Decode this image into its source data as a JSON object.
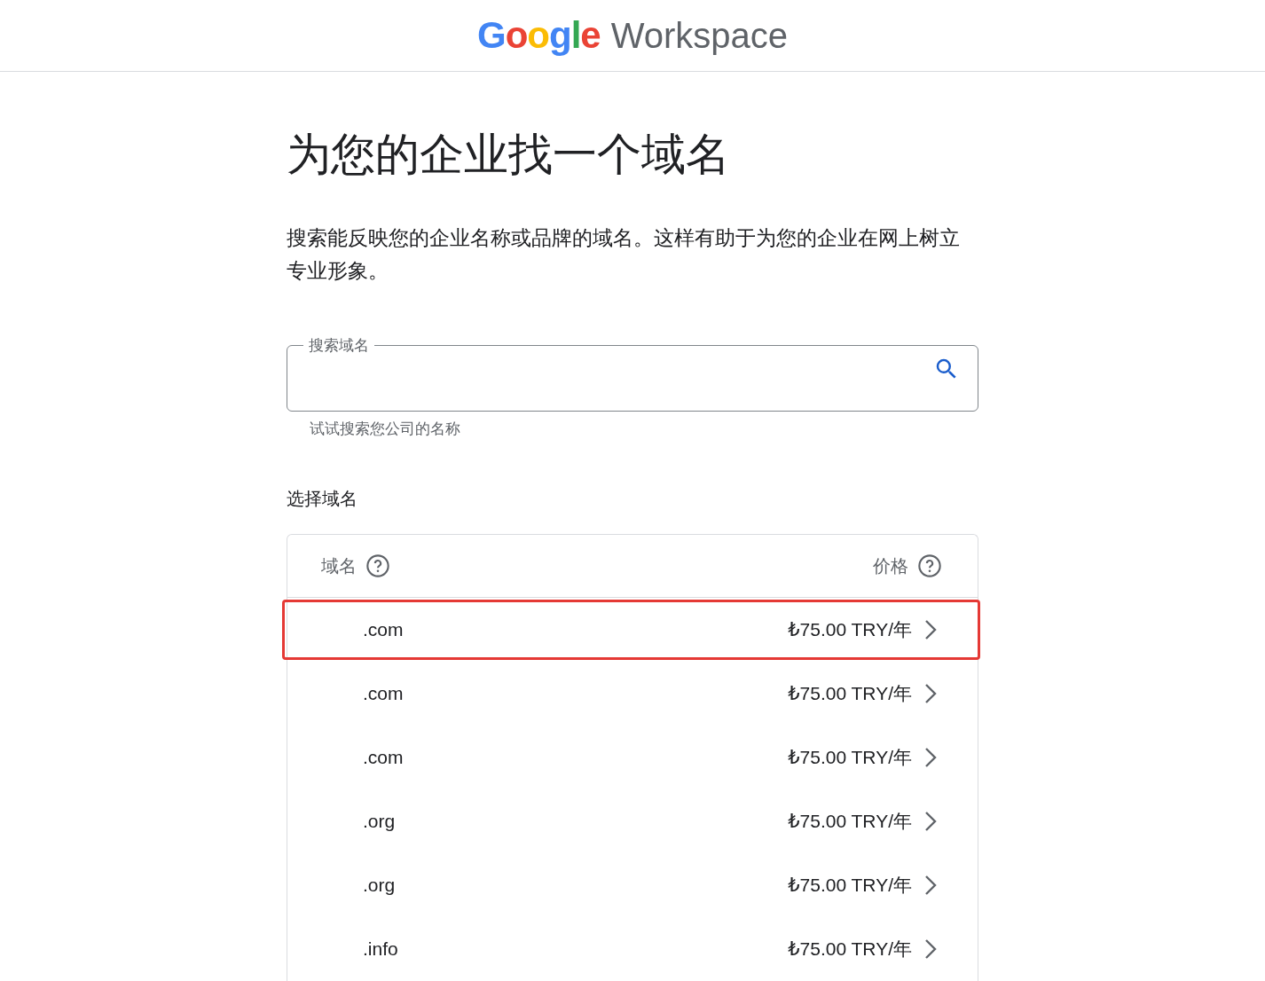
{
  "header": {
    "logo": {
      "brand": "Google",
      "product": "Workspace"
    }
  },
  "title": "为您的企业找一个域名",
  "description": "搜索能反映您的企业名称或品牌的域名。这样有助于为您的企业在网上树立专业形象。",
  "search": {
    "label": "搜索域名",
    "helper": "试试搜索您公司的名称"
  },
  "section_title": "选择域名",
  "table": {
    "columns": [
      "域名",
      "价格"
    ],
    "rows": [
      {
        "domain": ".com",
        "price": "₺75.00 TRY/年",
        "highlighted": true
      },
      {
        "domain": ".com",
        "price": "₺75.00 TRY/年",
        "highlighted": false
      },
      {
        "domain": ".com",
        "price": "₺75.00 TRY/年",
        "highlighted": false
      },
      {
        "domain": ".org",
        "price": "₺75.00 TRY/年",
        "highlighted": false
      },
      {
        "domain": ".org",
        "price": "₺75.00 TRY/年",
        "highlighted": false
      },
      {
        "domain": ".info",
        "price": "₺75.00 TRY/年",
        "highlighted": false
      }
    ]
  }
}
